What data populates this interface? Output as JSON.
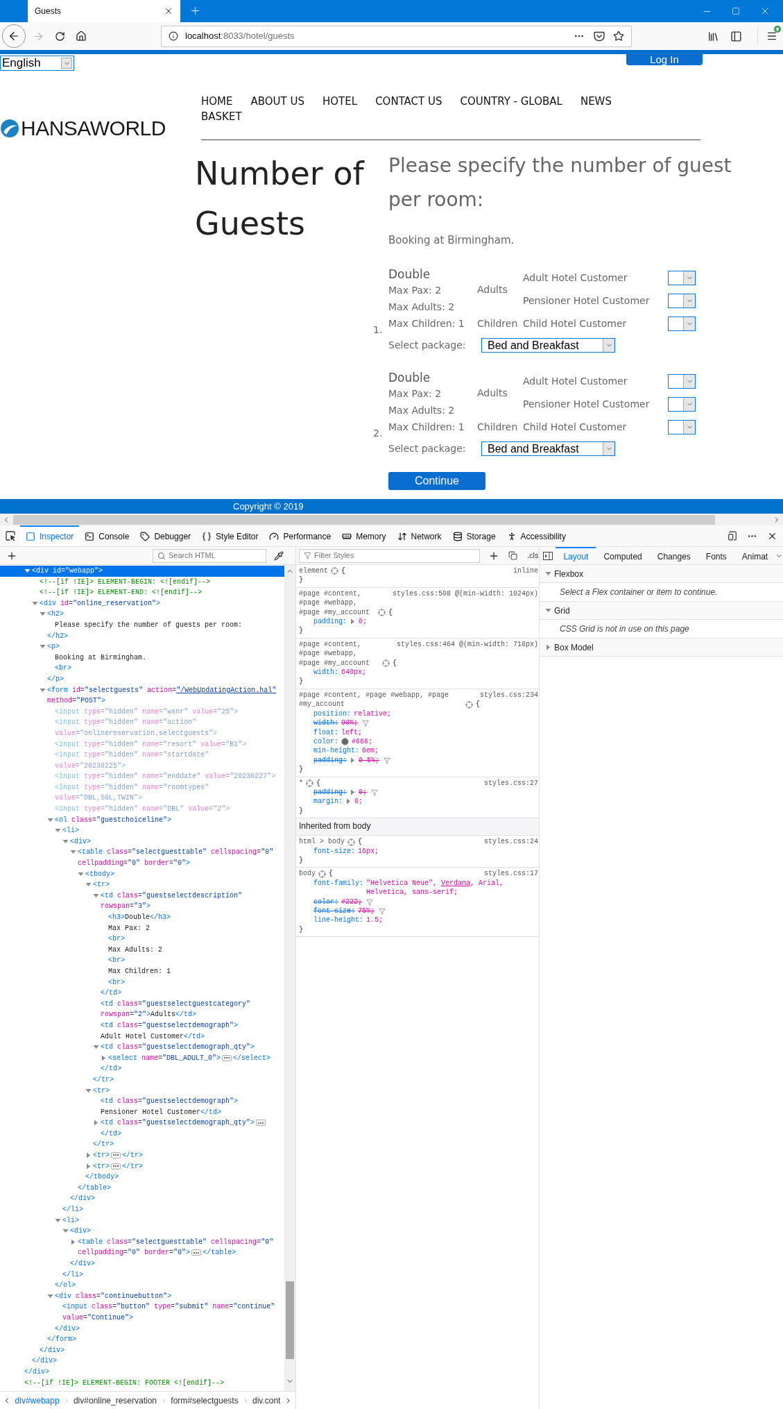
{
  "browser": {
    "tab": {
      "title": "Guests",
      "selected": true
    },
    "back_enabled": true,
    "forward_enabled": false,
    "url_host": "localhost",
    "url_rest": ":8033/hotel/guests"
  },
  "page": {
    "language": "English",
    "login": "Log In",
    "logo": "HANSAWORLD",
    "menu": [
      {
        "label": "HOME"
      },
      {
        "label": "ABOUT US"
      },
      {
        "label": "HOTEL"
      },
      {
        "label": "CONTACT US"
      },
      {
        "label": "COUNTRY - GLOBAL"
      },
      {
        "label": "NEWS"
      },
      {
        "label": "BASKET"
      }
    ],
    "heading": "Number of Guests",
    "subheading_lines": [
      "Please specify the number of guest",
      "per room:"
    ],
    "intro": "Booking at Birmingham.",
    "rooms": [
      {
        "number": "1.",
        "type": "Double",
        "details": [
          "Max Pax: 2",
          "Max Adults: 2",
          "Max Children: 1"
        ],
        "categories": [
          {
            "name": "Adults",
            "demographics": [
              {
                "label": "Adult Hotel Customer"
              },
              {
                "label": "Pensioner Hotel Customer"
              }
            ]
          },
          {
            "name": "Children",
            "demographics": [
              {
                "label": "Child Hotel Customer"
              }
            ]
          }
        ],
        "package_label": "Select package:",
        "package": "Bed and Breakfast"
      },
      {
        "number": "2.",
        "type": "Double",
        "details": [
          "Max Pax: 2",
          "Max Adults: 2",
          "Max Children: 1"
        ],
        "categories": [
          {
            "name": "Adults",
            "demographics": [
              {
                "label": "Adult Hotel Customer"
              },
              {
                "label": "Pensioner Hotel Customer"
              }
            ]
          },
          {
            "name": "Children",
            "demographics": [
              {
                "label": "Child Hotel Customer"
              }
            ]
          }
        ],
        "package_label": "Select package:",
        "package": "Bed and Breakfast"
      }
    ],
    "continue": "Continue",
    "copyright": "Copyright © 2019"
  },
  "devtools": {
    "tabs": [
      {
        "label": "Inspector",
        "selected": true
      },
      {
        "label": "Console",
        "selected": false
      },
      {
        "label": "Debugger",
        "selected": false
      },
      {
        "label": "Style Editor",
        "selected": false
      },
      {
        "label": "Performance",
        "selected": false
      },
      {
        "label": "Memory",
        "selected": false
      },
      {
        "label": "Network",
        "selected": false
      },
      {
        "label": "Storage",
        "selected": false
      },
      {
        "label": "Accessibility",
        "selected": false
      }
    ],
    "inspector": {
      "search_placeholder": "Search HTML",
      "tree": [
        {
          "expanded": true,
          "close": "</div>",
          "children": [
            {
              "open": "<div id=\"webapp\">",
              "expanded": true,
              "selected": true,
              "close": "</div>",
              "children": [
                {
                  "text": "<!--[if !IE]> ELEMENT-BEGIN: <![endif]-->",
                  "selected": false
                },
                {
                  "text": "<!--[if !IE]> ELEMENT-END: <![endif]-->",
                  "selected": false
                },
                {
                  "open": "<div id=\"online_reservation\">",
                  "expanded": true,
                  "selected": false,
                  "close": "</div>",
                  "children": [
                    {
                      "open": "<h2>",
                      "expanded": true,
                      "selected": false,
                      "close": "</h2>",
                      "children": [
                        {
                          "text": "Please specify the number of guests per room:",
                          "selected": false
                        }
                      ]
                    },
                    {
                      "open": "<p>",
                      "expanded": true,
                      "selected": false,
                      "close": "</p>",
                      "children": [
                        {
                          "text": "Booking at Birmingham.",
                          "selected": false
                        },
                        {
                          "text": "<br>",
                          "selected": false
                        }
                      ]
                    },
                    {
                      "open": [
                        "<form id=\"selectguests\" action=\"/WebUpdatingAction.hal\"",
                        "method=\"POST\">"
                      ],
                      "expanded": true,
                      "selected": false,
                      "close": "</form>",
                      "children": [
                        {
                          "text": "<input type=\"hidden\" name=\"wsnr\" value=\"25\">",
                          "selected": false,
                          "dimmed": true
                        },
                        {
                          "text": [
                            "<input type=\"hidden\" name=\"action\"",
                            "value=\"onlinereservation.selectguests\">"
                          ],
                          "selected": false,
                          "dimmed": true
                        },
                        {
                          "text": "<input type=\"hidden\" name=\"resort\" value=\"B1\">",
                          "selected": false,
                          "dimmed": true
                        },
                        {
                          "text": [
                            "<input type=\"hidden\" name=\"startdate\"",
                            "value=\"20230225\">"
                          ],
                          "selected": false,
                          "dimmed": true
                        },
                        {
                          "text": "<input type=\"hidden\" name=\"enddate\" value=\"20230227\">",
                          "selected": false,
                          "dimmed": true
                        },
                        {
                          "text": [
                            "<input type=\"hidden\" name=\"roomtypes\"",
                            "value=\"DBL,SGL,TWIN\">"
                          ],
                          "selected": false,
                          "dimmed": true
                        },
                        {
                          "text": "<input type=\"hidden\" name=\"DBL\" value=\"2\">",
                          "selected": false,
                          "dimmed": true
                        },
                        {
                          "open": "<ol class=\"guestchoiceline\">",
                          "expanded": true,
                          "selected": false,
                          "close": "</ol>",
                          "children": [
                            {
                              "open": "<li>",
                              "expanded": true,
                              "selected": false,
                              "close": "</li>",
                              "children": [
                                {
                                  "open": "<div>",
                                  "expanded": true,
                                  "selected": false,
                                  "close": "</div>",
                                  "children": [
                                    {
                                      "open": [
                                        "<table class=\"selectguesttable\" cellspacing=\"0\"",
                                        "cellpadding=\"0\" border=\"0\">"
                                      ],
                                      "expanded": true,
                                      "selected": false,
                                      "close": "</table>",
                                      "children": [
                                        {
                                          "open": "<tbody>",
                                          "expanded": true,
                                          "selected": false,
                                          "close": "</tbody>",
                                          "children": [
                                            {
                                              "open": "<tr>",
                                              "expanded": true,
                                              "selected": false,
                                              "close": "</tr>",
                                              "children": [
                                                {
                                                  "open": "<td class=\"guestselectdescription\" rowspan=\"3\">",
                                                  "expanded": true,
                                                  "selected": false,
                                                  "close": "</td>",
                                                  "children": [
                                                    {
                                                      "text": "<h3>Double</h3>",
                                                      "selected": false
                                                    },
                                                    {
                                                      "text": "Max Pax: 2",
                                                      "selected": false
                                                    },
                                                    {
                                                      "text": "<br>",
                                                      "selected": false
                                                    },
                                                    {
                                                      "text": "Max Adults: 2",
                                                      "selected": false
                                                    },
                                                    {
                                                      "text": "<br>",
                                                      "selected": false
                                                    },
                                                    {
                                                      "text": "Max Children: 1",
                                                      "selected": false
                                                    },
                                                    {
                                                      "text": "<br>",
                                                      "selected": false
                                                    }
                                                  ]
                                                },
                                                {
                                                  "open": "<td class=\"guestselectguestcategory\" rowspan=\"2\">",
                                                  "inline": "Adults",
                                                  "close": "</td>",
                                                  "selected": false
                                                },
                                                {
                                                  "open": "<td class=\"guestselectdemograph\">",
                                                  "inline": "Adult Hotel Customer",
                                                  "close": "</td>",
                                                  "selected": false
                                                },
                                                {
                                                  "open": "<td class=\"guestselectdemograph_qty\">",
                                                  "expanded": true,
                                                  "selected": false,
                                                  "close": "</td>",
                                                  "children": [
                                                    {
                                                      "open": "<select name=\"DBL_ADULT_0\">",
                                                      "expanded": false,
                                                      "selected": false,
                                                      "close": "</select>"
                                                    }
                                                  ]
                                                }
                                              ]
                                            },
                                            {
                                              "open": "<tr>",
                                              "expanded": true,
                                              "selected": false,
                                              "close": "</tr>",
                                              "children": [
                                                {
                                                  "open": "<td class=\"guestselectdemograph\">",
                                                  "inline": "Pensioner Hotel Customer",
                                                  "close": "</td>",
                                                  "selected": false
                                                },
                                                {
                                                  "open": "<td class=\"guestselectdemograph_qty\">",
                                                  "expanded": false,
                                                  "selected": false,
                                                  "close": "</td>"
                                                }
                                              ]
                                            },
                                            {
                                              "open": "<tr>",
                                              "expanded": false,
                                              "selected": false,
                                              "close": "</tr>"
                                            },
                                            {
                                              "open": "<tr>",
                                              "expanded": false,
                                              "selected": false,
                                              "close": "</tr>"
                                            }
                                          ]
                                        }
                                      ]
                                    }
                                  ]
                                }
                              ]
                            },
                            {
                              "open": "<li>",
                              "expanded": true,
                              "selected": false,
                              "close": "</li>",
                              "children": [
                                {
                                  "open": "<div>",
                                  "expanded": true,
                                  "selected": false,
                                  "close": "</div>",
                                  "children": [
                                    {
                                      "open": [
                                        "<table class=\"selectguesttable\" cellspacing=\"0\"",
                                        "cellpadding=\"0\" border=\"0\">"
                                      ],
                                      "expanded": false,
                                      "selected": false,
                                      "close": "</table>"
                                    }
                                  ]
                                }
                              ]
                            }
                          ]
                        },
                        {
                          "open": "<div class=\"continuebutton\">",
                          "expanded": true,
                          "selected": false,
                          "close": "</div>",
                          "children": [
                            {
                              "text": [
                                "<input class=\"button\" type=\"submit\" name=\"continue\"",
                                "value=\"Continue\">"
                              ],
                              "selected": false
                            }
                          ]
                        }
                      ]
                    }
                  ]
                }
              ]
            }
          ]
        },
        {
          "text": "<!--[if !IE]> ELEMENT-BEGIN: FOOTER <![endif]-->",
          "selected": false
        }
      ]
    },
    "breadcrumbs": [
      {
        "label": "div#webapp",
        "selected": true
      },
      {
        "label": "div#online_reservation",
        "selected": false
      },
      {
        "label": "form#selectguests",
        "selected": false
      },
      {
        "label": "div.cont",
        "selected": false
      }
    ],
    "rules": {
      "filter_placeholder": "Filter Styles",
      "cls": ".cls",
      "items": [
        {
          "kind": "rule",
          "selector": "element",
          "source": "inline",
          "open": "{",
          "close": "}"
        },
        {
          "kind": "rule",
          "selector": "#page #content, #page #webapp, #page #my_account",
          "source": "styles.css:508 @(min-width: 1024px)",
          "open": "{",
          "close": "}",
          "properties": [
            {
              "kind": "shorthand",
              "name": "padding:",
              "value": "0;",
              "overridden": false
            }
          ]
        },
        {
          "kind": "rule",
          "selector": "#page #content, #page #webapp, #page #my_account",
          "source": "styles.css:464 @(min-width: 718px)",
          "open": "{",
          "close": "}",
          "properties": [
            {
              "kind": "plain",
              "name": "width:",
              "value": "640px;",
              "overridden": false
            }
          ]
        },
        {
          "kind": "rule",
          "selector": "#page #content, #page #webapp, #page #my_account",
          "source": "styles.css:234",
          "open": "{",
          "close": "}",
          "properties": [
            {
              "kind": "plain",
              "name": "position:",
              "value": "relative;",
              "overridden": false
            },
            {
              "kind": "plain",
              "name": "width:",
              "value": "90%;",
              "overridden": true
            },
            {
              "kind": "plain",
              "name": "float:",
              "value": "left;",
              "overridden": false
            },
            {
              "kind": "color",
              "name": "color:",
              "value": "#666;",
              "color": "#666666",
              "overridden": false
            },
            {
              "kind": "plain",
              "name": "min-height:",
              "value": "6em;",
              "overridden": false
            },
            {
              "kind": "shorthand",
              "name": "padding:",
              "value": "0 5%;",
              "overridden": true
            }
          ]
        },
        {
          "kind": "rule",
          "selector": "*",
          "source": "styles.css:27",
          "open": "{",
          "close": "}",
          "properties": [
            {
              "kind": "shorthand",
              "name": "padding:",
              "value": "0;",
              "overridden": true
            },
            {
              "kind": "shorthand",
              "name": "margin:",
              "value": "0;",
              "overridden": false
            }
          ]
        },
        {
          "kind": "header",
          "text": "Inherited from body"
        },
        {
          "kind": "rule",
          "selector": "html > body",
          "source": "styles.css:24",
          "open": "{",
          "close": "}",
          "properties": [
            {
              "kind": "plain",
              "name": "font-size:",
              "value": "16px;",
              "overridden": false
            }
          ]
        },
        {
          "kind": "rule",
          "selector": "body",
          "source": "styles.css:17",
          "open": "{",
          "close": "}",
          "properties": [
            {
              "kind": "font",
              "name": "font-family:",
              "value_parts": [
                {
                  "text": "\"Helvetica Neue\", ",
                  "used": false
                },
                {
                  "text": "Verdana",
                  "used": true
                },
                {
                  "text": ", Arial, Helvetica, sans-serif;",
                  "used": false
                }
              ],
              "overridden": false
            },
            {
              "kind": "plain",
              "name": "color:",
              "value": "#222;",
              "overridden": true
            },
            {
              "kind": "plain",
              "name": "font-size:",
              "value": "75%;",
              "overridden": true
            },
            {
              "kind": "plain",
              "name": "line-height:",
              "value": "1.5;",
              "overridden": false
            }
          ]
        }
      ]
    },
    "sidebar": {
      "tabs": [
        {
          "label": "Layout",
          "selected": true
        },
        {
          "label": "Computed",
          "selected": false
        },
        {
          "label": "Changes",
          "selected": false
        },
        {
          "label": "Fonts",
          "selected": false
        },
        {
          "label": "Animat",
          "selected": false
        }
      ],
      "sections": [
        {
          "title": "Flexbox",
          "expanded": true,
          "message": "Select a Flex container or item to continue."
        },
        {
          "title": "Grid",
          "expanded": true,
          "message": "CSS Grid is not in use on this page"
        },
        {
          "title": "Box Model",
          "expanded": false
        }
      ]
    }
  }
}
